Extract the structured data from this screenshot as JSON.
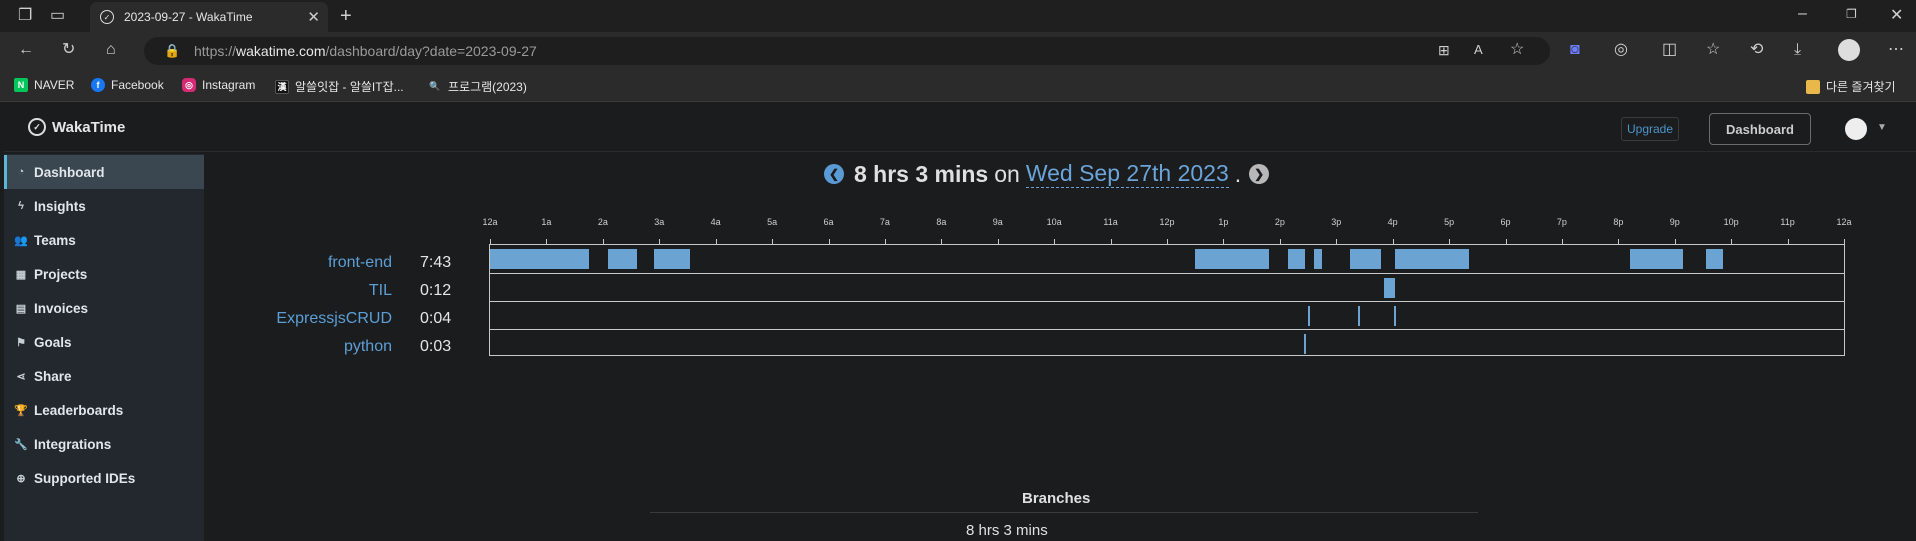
{
  "browser": {
    "tab_title": "2023-09-27 - WakaTime",
    "url_host": "wakatime.com",
    "url_scheme": "https://",
    "url_path": "/dashboard/day?date=2023-09-27",
    "bookmarks": [
      {
        "label": "NAVER",
        "icon": "naver-icon",
        "color": "#03c75a"
      },
      {
        "label": "Facebook",
        "icon": "facebook-icon",
        "color": "#1877f2"
      },
      {
        "label": "Instagram",
        "icon": "instagram-icon",
        "color": "#d62976"
      },
      {
        "label": "알쓸잇잡 - 알쓸IT잡...",
        "icon": "site-icon",
        "color": "#111111"
      },
      {
        "label": "프로그램(2023)",
        "icon": "search-icon",
        "color": "#444444"
      }
    ],
    "other_bookmarks": "다른 즐겨찾기"
  },
  "app": {
    "brand": "WakaTime",
    "upgrade_label": "Upgrade",
    "dashboard_label": "Dashboard",
    "sidebar": [
      {
        "label": "Dashboard",
        "icon": "dashboard-icon",
        "glyph": "◔",
        "active": true
      },
      {
        "label": "Insights",
        "icon": "bolt-icon",
        "glyph": "ϟ",
        "active": false
      },
      {
        "label": "Teams",
        "icon": "users-icon",
        "glyph": "👥",
        "active": false
      },
      {
        "label": "Projects",
        "icon": "grid-icon",
        "glyph": "▦",
        "active": false
      },
      {
        "label": "Invoices",
        "icon": "invoice-icon",
        "glyph": "▤",
        "active": false
      },
      {
        "label": "Goals",
        "icon": "flag-icon",
        "glyph": "⚑",
        "active": false
      },
      {
        "label": "Share",
        "icon": "share-icon",
        "glyph": "⋖",
        "active": false
      },
      {
        "label": "Leaderboards",
        "icon": "trophy-icon",
        "glyph": "🏆",
        "active": false
      },
      {
        "label": "Integrations",
        "icon": "wrench-icon",
        "glyph": "🔧",
        "active": false
      },
      {
        "label": "Supported IDEs",
        "icon": "plus-circle-icon",
        "glyph": "⊕",
        "active": false
      }
    ],
    "summary": {
      "total": "8 hrs 3 mins",
      "on": "on",
      "date": "Wed Sep 27th 2023",
      "dot": "."
    },
    "hours": [
      "12a",
      "1a",
      "2a",
      "3a",
      "4a",
      "5a",
      "6a",
      "7a",
      "8a",
      "9a",
      "10a",
      "11a",
      "12p",
      "1p",
      "2p",
      "3p",
      "4p",
      "5p",
      "6p",
      "7p",
      "8p",
      "9p",
      "10p",
      "11p",
      "12a"
    ],
    "projects": [
      {
        "name": "front-end",
        "time": "7:43",
        "segments": [
          [
            0.0,
            1.75
          ],
          [
            2.1,
            2.6
          ],
          [
            2.9,
            3.55
          ],
          [
            12.5,
            13.8
          ],
          [
            14.15,
            14.45
          ],
          [
            14.6,
            14.75
          ],
          [
            15.25,
            15.8
          ],
          [
            16.05,
            17.35
          ],
          [
            20.2,
            21.15
          ],
          [
            21.55,
            21.85
          ]
        ]
      },
      {
        "name": "TIL",
        "time": "0:12",
        "segments": [
          [
            15.85,
            16.05
          ]
        ]
      },
      {
        "name": "ExpressjsCRUD",
        "time": "0:04",
        "segments": [
          [
            14.5,
            14.54
          ],
          [
            15.38,
            15.4
          ],
          [
            16.02,
            16.06
          ]
        ]
      },
      {
        "name": "python",
        "time": "0:03",
        "segments": [
          [
            14.42,
            14.47
          ]
        ]
      }
    ],
    "branches_title": "Branches",
    "branches_total": "8 hrs 3 mins"
  }
}
